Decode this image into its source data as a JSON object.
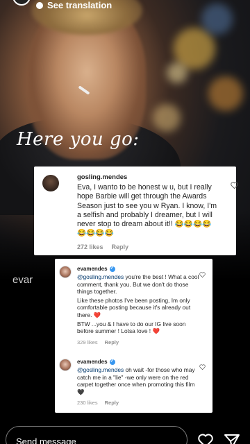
{
  "header": {
    "translation_label": "See translation"
  },
  "caption": "Here you go:",
  "comment1": {
    "username": "gosling.mendes",
    "text": "Eva, I wanto to be honest w u, but I really hope Barbie will get through the Awards Season just to see you w Ryan. I know, I'm a selfish and probably I dreamer, but I will never stop to dream about it!! 😂😂😂😂😂😂😂😂",
    "likes": "272 likes",
    "reply": "Reply"
  },
  "story_user_label": "evar",
  "reply1": {
    "username": "evamendes",
    "mention": "@gosling.mendes",
    "text_a": " you're the best ! What a cool comment, thank you. But we don't do those things together.",
    "text_b": "Like these photos I've been posting, Im only comfortable posting because it's already out there. ❤️",
    "text_c": "BTW ...you & I have to do our IG live soon before summer ! Lotsa love ! ❤️",
    "likes": "329 likes",
    "reply": "Reply"
  },
  "reply2": {
    "username": "evamendes",
    "mention": "@gosling.mendes",
    "text": " oh wait -for those who may catch me in a \"lie\" -we only were on the red carpet together once when promoting this film 🖤",
    "likes": "230 likes",
    "reply": "Reply"
  },
  "footer": {
    "send_placeholder": "Send message"
  },
  "colors": {
    "mention": "#00376b",
    "verified": "#3897f0",
    "meta": "#8e8e8e"
  }
}
